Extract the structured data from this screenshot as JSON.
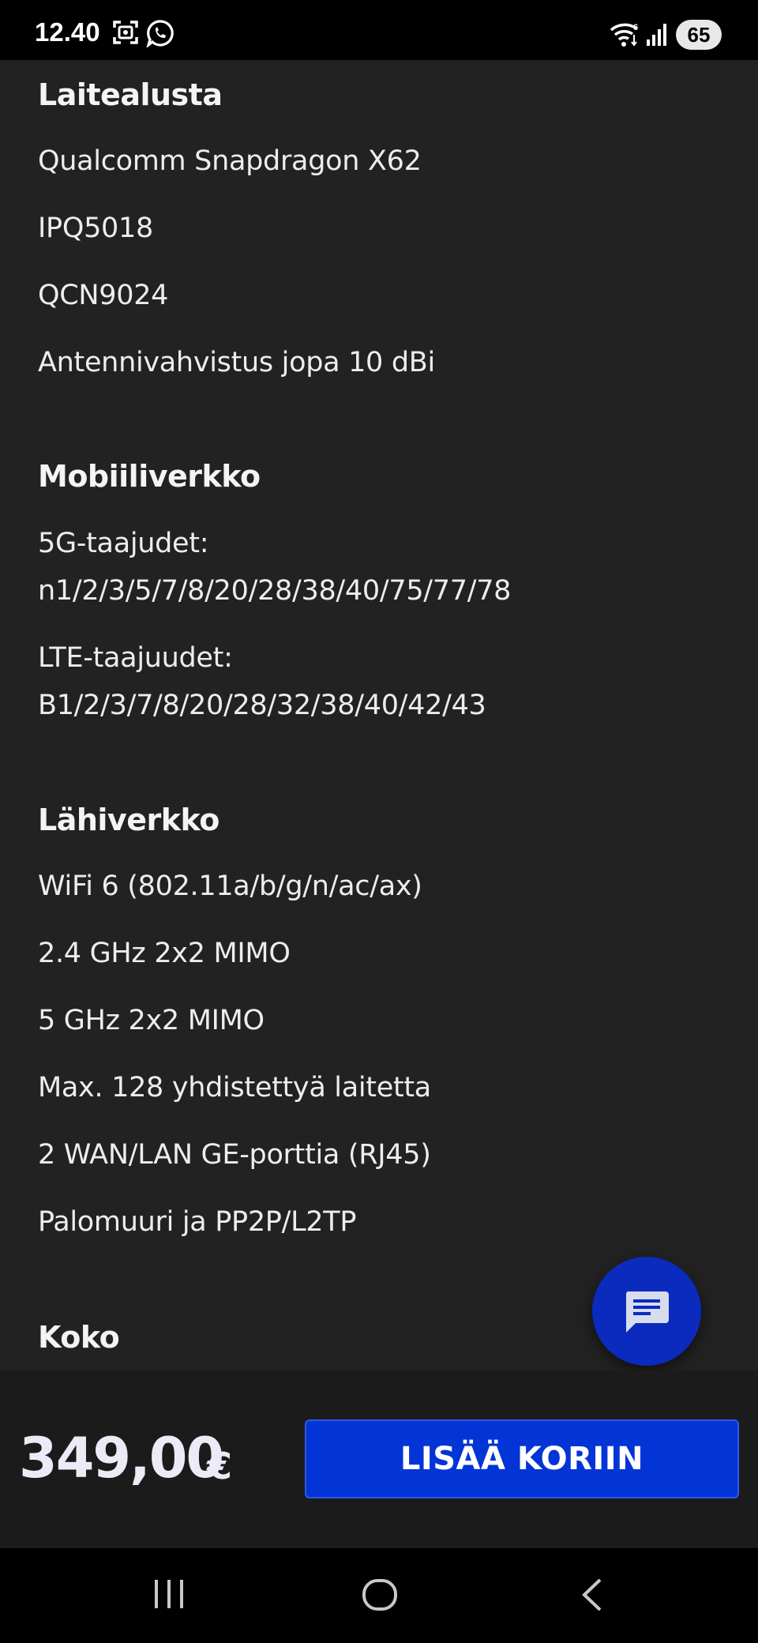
{
  "status_bar": {
    "time": "12.40",
    "battery": "65",
    "icons": [
      "screenshot-icon",
      "whatsapp-icon",
      "wifi-icon",
      "signal-icon"
    ]
  },
  "sections": {
    "platform": {
      "title": "Laitealusta",
      "lines": [
        "Qualcomm Snapdragon X62",
        "IPQ5018",
        "QCN9024",
        "Antennivahvistus jopa 10 dBi"
      ]
    },
    "mobile": {
      "title": "Mobiiliverkko",
      "lines": [
        "5G-taajudet:",
        "n1/2/3/5/7/8/20/28/38/40/75/77/78",
        "LTE-taajuudet:",
        "B1/2/3/7/8/20/28/32/38/40/42/43"
      ]
    },
    "lan": {
      "title": "Lähiverkko",
      "lines": [
        "WiFi 6 (802.11a/b/g/n/ac/ax)",
        "2.4 GHz 2x2 MIMO",
        "5 GHz 2x2 MIMO",
        "Max. 128 yhdistettyä laitetta",
        "2 WAN/LAN GE-porttia (RJ45)",
        "Palomuuri ja PP2P/L2TP"
      ]
    },
    "size": {
      "title": "Koko"
    }
  },
  "purchase": {
    "price": "349,00",
    "currency": "€",
    "button_label": "LISÄÄ KORIIN"
  },
  "colors": {
    "background": "#222222",
    "accent": "#0334d6",
    "fab": "#0a2bbd"
  }
}
